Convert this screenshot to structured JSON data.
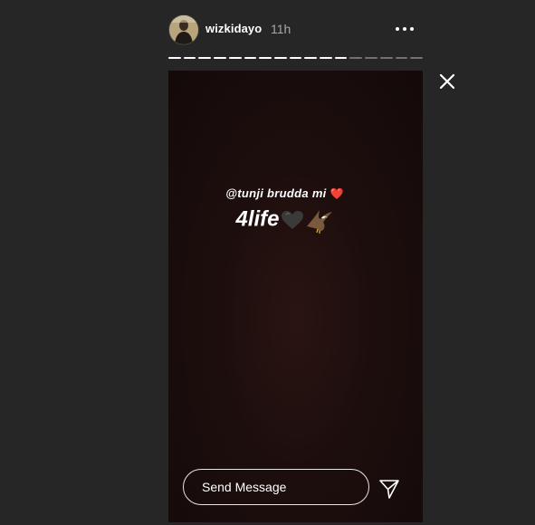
{
  "header": {
    "username": "wizkidayo",
    "timestamp": "11h",
    "avatar_icon": "profile-photo",
    "more_icon": "ellipsis-icon"
  },
  "progress": {
    "total_segments": 17,
    "completed_segments": 12
  },
  "story": {
    "caption_line1": "@tunji brudda mi",
    "caption_line1_emoji": "❤️",
    "caption_line2": "4life",
    "caption_line2_emojis": [
      "black-heart",
      "eagle"
    ]
  },
  "reply": {
    "placeholder": "Send Message",
    "value": ""
  },
  "icons": {
    "close": "close-icon",
    "send": "paper-plane-icon"
  },
  "colors": {
    "background": "#262626",
    "story_background": "#1c0e0d",
    "text": "#ffffff",
    "muted_text": "#a8a8a8",
    "heart": "#e0323c"
  }
}
